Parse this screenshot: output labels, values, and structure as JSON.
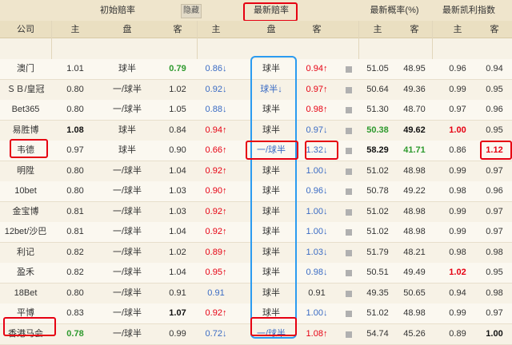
{
  "headers": {
    "initial_odds": "初始赔率",
    "hide": "隐藏",
    "latest_odds": "最新赔率",
    "latest_prob": "最新概率(%)",
    "kelly": "最新凯利指数",
    "col_company": "公司",
    "col_home": "主",
    "col_line": "盘",
    "col_away": "客"
  },
  "rows": [
    {
      "company": "澳门",
      "i_home": "1.01",
      "i_line": "球半",
      "i_away": "0.79",
      "l_home": "0.86↓",
      "l_line": "球半",
      "l_away": "0.94↑",
      "p_home": "51.05",
      "p_away": "48.95",
      "k_home": "0.96",
      "k_away": "0.94"
    },
    {
      "company": "ＳＢ/皇冠",
      "i_home": "0.80",
      "i_line": "一/球半",
      "i_away": "1.02",
      "l_home": "0.92↓",
      "l_line": "球半↓",
      "l_away": "0.97↑",
      "p_home": "50.64",
      "p_away": "49.36",
      "k_home": "0.99",
      "k_away": "0.95"
    },
    {
      "company": "Bet365",
      "i_home": "0.80",
      "i_line": "一/球半",
      "i_away": "1.05",
      "l_home": "0.88↓",
      "l_line": "球半",
      "l_away": "0.98↑",
      "p_home": "51.30",
      "p_away": "48.70",
      "k_home": "0.97",
      "k_away": "0.96"
    },
    {
      "company": "易胜博",
      "i_home": "1.08",
      "i_line": "球半",
      "i_away": "0.84",
      "l_home": "0.94↑",
      "l_line": "球半",
      "l_away": "0.97↓",
      "p_home": "50.38",
      "p_away": "49.62",
      "k_home": "1.00",
      "k_away": "0.95"
    },
    {
      "company": "韦德",
      "i_home": "0.97",
      "i_line": "球半",
      "i_away": "0.90",
      "l_home": "0.66↑",
      "l_line": "一/球半",
      "l_away": "1.32↓",
      "p_home": "58.29",
      "p_away": "41.71",
      "k_home": "0.86",
      "k_away": "1.12"
    },
    {
      "company": "明陞",
      "i_home": "0.80",
      "i_line": "一/球半",
      "i_away": "1.04",
      "l_home": "0.92↑",
      "l_line": "球半",
      "l_away": "1.00↓",
      "p_home": "51.02",
      "p_away": "48.98",
      "k_home": "0.99",
      "k_away": "0.97"
    },
    {
      "company": "10bet",
      "i_home": "0.80",
      "i_line": "一/球半",
      "i_away": "1.03",
      "l_home": "0.90↑",
      "l_line": "球半",
      "l_away": "0.96↓",
      "p_home": "50.78",
      "p_away": "49.22",
      "k_home": "0.98",
      "k_away": "0.96"
    },
    {
      "company": "金宝博",
      "i_home": "0.81",
      "i_line": "一/球半",
      "i_away": "1.03",
      "l_home": "0.92↑",
      "l_line": "球半",
      "l_away": "1.00↓",
      "p_home": "51.02",
      "p_away": "48.98",
      "k_home": "0.99",
      "k_away": "0.97"
    },
    {
      "company": "12bet/沙巴",
      "i_home": "0.81",
      "i_line": "一/球半",
      "i_away": "1.04",
      "l_home": "0.92↑",
      "l_line": "球半",
      "l_away": "1.00↓",
      "p_home": "51.02",
      "p_away": "48.98",
      "k_home": "0.99",
      "k_away": "0.97"
    },
    {
      "company": "利记",
      "i_home": "0.82",
      "i_line": "一/球半",
      "i_away": "1.02",
      "l_home": "0.89↑",
      "l_line": "球半",
      "l_away": "1.03↓",
      "p_home": "51.79",
      "p_away": "48.21",
      "k_home": "0.98",
      "k_away": "0.98"
    },
    {
      "company": "盈禾",
      "i_home": "0.82",
      "i_line": "一/球半",
      "i_away": "1.04",
      "l_home": "0.95↑",
      "l_line": "球半",
      "l_away": "0.98↓",
      "p_home": "50.51",
      "p_away": "49.49",
      "k_home": "1.02",
      "k_away": "0.95"
    },
    {
      "company": "18Bet",
      "i_home": "0.80",
      "i_line": "一/球半",
      "i_away": "0.91",
      "l_home": "0.91",
      "l_line": "球半",
      "l_away": "0.91",
      "p_home": "49.35",
      "p_away": "50.65",
      "k_home": "0.94",
      "k_away": "0.98"
    },
    {
      "company": "平博",
      "i_home": "0.83",
      "i_line": "一/球半",
      "i_away": "1.07",
      "l_home": "0.92↑",
      "l_line": "球半",
      "l_away": "1.00↓",
      "p_home": "51.02",
      "p_away": "48.98",
      "k_home": "0.99",
      "k_away": "0.97"
    },
    {
      "company": "香港马会",
      "i_home": "0.78",
      "i_line": "一/球半",
      "i_away": "0.99",
      "l_home": "0.72↓",
      "l_line": "一/球半",
      "l_away": "1.08↑",
      "p_home": "54.74",
      "p_away": "45.26",
      "k_home": "0.89",
      "k_away": "1.00"
    }
  ]
}
